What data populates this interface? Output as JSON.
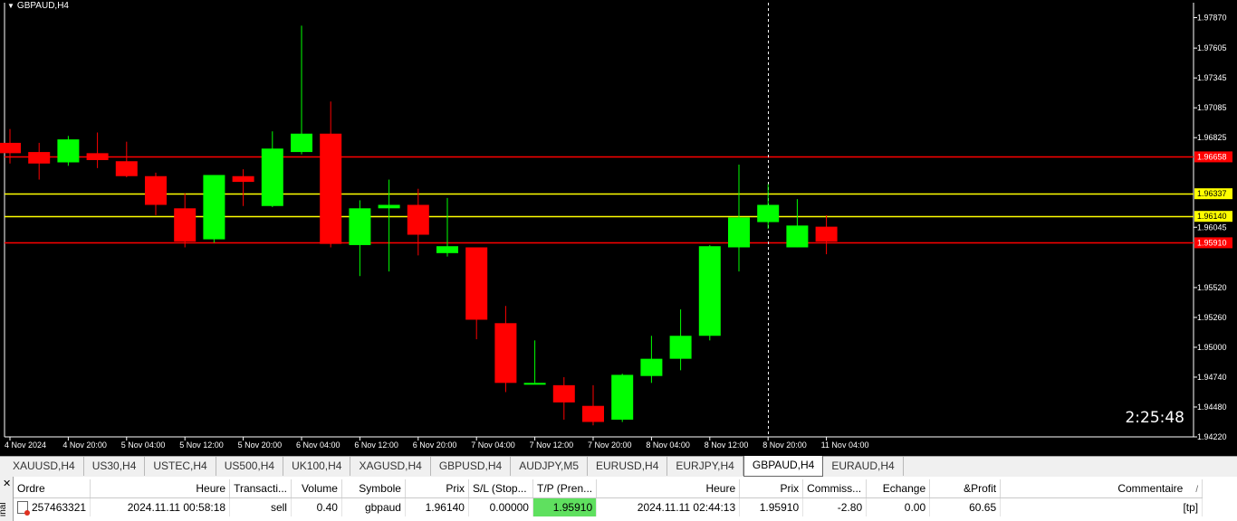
{
  "chart": {
    "title": "GBPAUD,H4",
    "timer": "2:25:48",
    "colors": {
      "bull": "#00ff00",
      "bear": "#ff0000",
      "background": "#000000",
      "foreground": "#ffffff",
      "tp_line": "#ff0000",
      "entry_line": "#ffff00"
    }
  },
  "chart_data": {
    "type": "candlestick",
    "title": "GBPAUD,H4",
    "y_ticks": [
      "1.97870",
      "1.97605",
      "1.97345",
      "1.97085",
      "1.96825",
      "1.96045",
      "1.95520",
      "1.95260",
      "1.95000",
      "1.94740",
      "1.94480",
      "1.94220"
    ],
    "ylim": [
      1.9422,
      1.98
    ],
    "x_ticks": [
      {
        "index": 0,
        "label": "4 Nov 2024"
      },
      {
        "index": 2,
        "label": "4 Nov 20:00"
      },
      {
        "index": 4,
        "label": "5 Nov 04:00"
      },
      {
        "index": 6,
        "label": "5 Nov 12:00"
      },
      {
        "index": 8,
        "label": "5 Nov 20:00"
      },
      {
        "index": 10,
        "label": "6 Nov 04:00"
      },
      {
        "index": 12,
        "label": "6 Nov 12:00"
      },
      {
        "index": 14,
        "label": "6 Nov 20:00"
      },
      {
        "index": 16,
        "label": "7 Nov 04:00"
      },
      {
        "index": 18,
        "label": "7 Nov 12:00"
      },
      {
        "index": 20,
        "label": "7 Nov 20:00"
      },
      {
        "index": 22,
        "label": "8 Nov 04:00"
      },
      {
        "index": 24,
        "label": "8 Nov 12:00"
      },
      {
        "index": 26,
        "label": "8 Nov 20:00"
      },
      {
        "index": 28,
        "label": "11 Nov 04:00"
      }
    ],
    "candles": [
      {
        "o": 1.9678,
        "h": 1.969,
        "l": 1.966,
        "c": 1.9669
      },
      {
        "o": 1.967,
        "h": 1.9678,
        "l": 1.9646,
        "c": 1.966
      },
      {
        "o": 1.9661,
        "h": 1.9684,
        "l": 1.9658,
        "c": 1.9681
      },
      {
        "o": 1.9669,
        "h": 1.9687,
        "l": 1.9656,
        "c": 1.9663
      },
      {
        "o": 1.9662,
        "h": 1.9679,
        "l": 1.9648,
        "c": 1.9649
      },
      {
        "o": 1.9649,
        "h": 1.9652,
        "l": 1.9615,
        "c": 1.9624
      },
      {
        "o": 1.9621,
        "h": 1.9634,
        "l": 1.9587,
        "c": 1.9592
      },
      {
        "o": 1.9594,
        "h": 1.965,
        "l": 1.9591,
        "c": 1.965
      },
      {
        "o": 1.9649,
        "h": 1.9655,
        "l": 1.9623,
        "c": 1.9644
      },
      {
        "o": 1.9623,
        "h": 1.9688,
        "l": 1.9622,
        "c": 1.9673
      },
      {
        "o": 1.967,
        "h": 1.978,
        "l": 1.9668,
        "c": 1.9686
      },
      {
        "o": 1.9686,
        "h": 1.9714,
        "l": 1.9587,
        "c": 1.959
      },
      {
        "o": 1.9589,
        "h": 1.9628,
        "l": 1.9562,
        "c": 1.9621
      },
      {
        "o": 1.9621,
        "h": 1.9646,
        "l": 1.9566,
        "c": 1.9624
      },
      {
        "o": 1.9624,
        "h": 1.9638,
        "l": 1.958,
        "c": 1.9598
      },
      {
        "o": 1.9582,
        "h": 1.963,
        "l": 1.9579,
        "c": 1.9588
      },
      {
        "o": 1.9587,
        "h": 1.9587,
        "l": 1.9507,
        "c": 1.9524
      },
      {
        "o": 1.9521,
        "h": 1.9536,
        "l": 1.9461,
        "c": 1.9469
      },
      {
        "o": 1.9469,
        "h": 1.9506,
        "l": 1.9469,
        "c": 1.9469
      },
      {
        "o": 1.9467,
        "h": 1.9474,
        "l": 1.9437,
        "c": 1.9452
      },
      {
        "o": 1.9449,
        "h": 1.9467,
        "l": 1.9432,
        "c": 1.9435
      },
      {
        "o": 1.9437,
        "h": 1.9477,
        "l": 1.9435,
        "c": 1.9476
      },
      {
        "o": 1.9475,
        "h": 1.951,
        "l": 1.9469,
        "c": 1.949
      },
      {
        "o": 1.949,
        "h": 1.9533,
        "l": 1.948,
        "c": 1.951
      },
      {
        "o": 1.951,
        "h": 1.9589,
        "l": 1.9506,
        "c": 1.9588
      },
      {
        "o": 1.9587,
        "h": 1.9659,
        "l": 1.9566,
        "c": 1.9613
      },
      {
        "o": 1.9609,
        "h": 1.9642,
        "l": 1.9603,
        "c": 1.9624
      },
      {
        "o": 1.9587,
        "h": 1.9629,
        "l": 1.9587,
        "c": 1.9606
      },
      {
        "o": 1.9605,
        "h": 1.9615,
        "l": 1.9581,
        "c": 1.9592
      }
    ],
    "levels": [
      {
        "price": 1.96658,
        "label": "1.96658",
        "color": "#ff0000",
        "label_bg": "#ff0000",
        "label_color": "#ffffff"
      },
      {
        "price": 1.96337,
        "label": "1.96337",
        "color": "#ffff00",
        "label_bg": "#ffff00",
        "label_color": "#000000"
      },
      {
        "price": 1.9614,
        "label": "1.96140",
        "color": "#ffff00",
        "label_bg": "#ffff00",
        "label_color": "#000000"
      },
      {
        "price": 1.9591,
        "label": "1.95910",
        "color": "#ff0000",
        "label_bg": "#ff0000",
        "label_color": "#ffffff"
      }
    ],
    "crosshair_index": 26,
    "grid": false
  },
  "tabs": [
    {
      "label": "XAUUSD,H4",
      "active": false
    },
    {
      "label": "US30,H4",
      "active": false
    },
    {
      "label": "USTEC,H4",
      "active": false
    },
    {
      "label": "US500,H4",
      "active": false
    },
    {
      "label": "UK100,H4",
      "active": false
    },
    {
      "label": "XAGUSD,H4",
      "active": false
    },
    {
      "label": "GBPUSD,H4",
      "active": false
    },
    {
      "label": "AUDJPY,M5",
      "active": false
    },
    {
      "label": "EURUSD,H4",
      "active": false
    },
    {
      "label": "EURJPY,H4",
      "active": false
    },
    {
      "label": "GBPAUD,H4",
      "active": true
    },
    {
      "label": "EURAUD,H4",
      "active": false
    }
  ],
  "terminal": {
    "side_label": "inal",
    "columns": [
      "Ordre",
      "Heure",
      "Transacti...",
      "Volume",
      "Symbole",
      "Prix",
      "S/L (Stop...",
      "T/P (Pren...",
      "Heure",
      "Prix",
      "Commiss...",
      "Echange",
      "&Profit",
      "Commentaire"
    ],
    "sort_indicator": "/",
    "row": {
      "ordre": "257463321",
      "heure_open": "2024.11.11 00:58:18",
      "transaction": "sell",
      "volume": "0.40",
      "symbole": "gbpaud",
      "prix_open": "1.96140",
      "sl": "0.00000",
      "tp": "1.95910",
      "heure_close": "2024.11.11 02:44:13",
      "prix_close": "1.95910",
      "commission": "-2.80",
      "echange": "0.00",
      "profit": "60.65",
      "commentaire": "[tp]"
    }
  }
}
